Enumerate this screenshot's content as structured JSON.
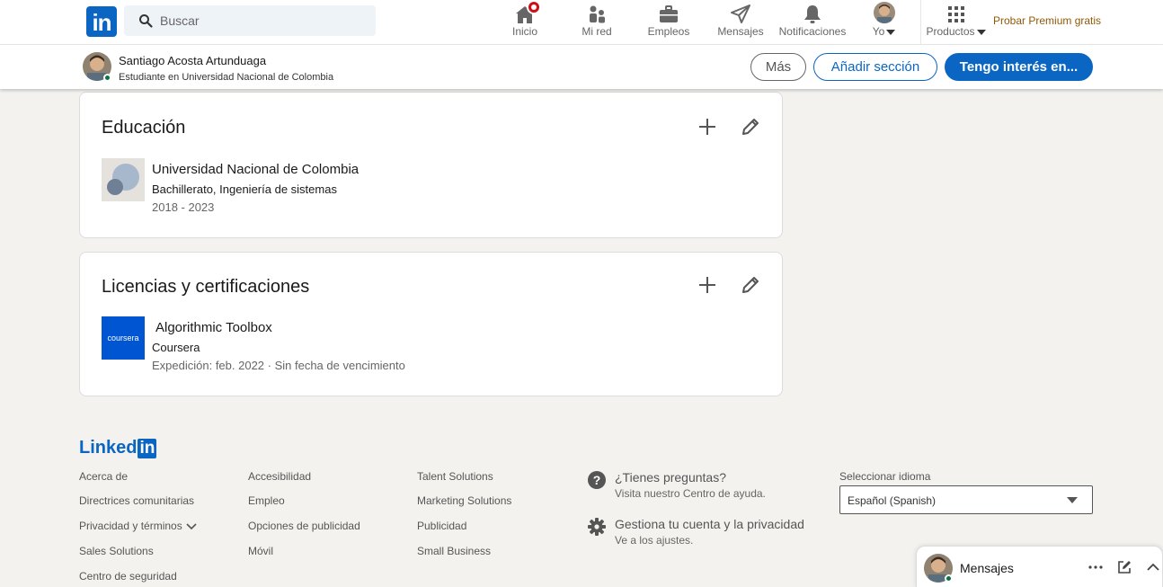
{
  "nav": {
    "logo": "in",
    "search_placeholder": "Buscar",
    "items": [
      {
        "label": "Inicio",
        "icon": "home-icon"
      },
      {
        "label": "Mi red",
        "icon": "people-icon"
      },
      {
        "label": "Empleos",
        "icon": "briefcase-icon"
      },
      {
        "label": "Mensajes",
        "icon": "send-icon"
      },
      {
        "label": "Notificaciones",
        "icon": "bell-icon"
      },
      {
        "label": "Yo",
        "icon": "avatar"
      },
      {
        "label": "Productos",
        "icon": "grid-icon"
      }
    ],
    "premium": "Probar Premium gratis",
    "accent": "#0a66c2",
    "notification_color": "#cc1016"
  },
  "profile_bar": {
    "name": "Santiago Acosta Artunduaga",
    "headline": "Estudiante en Universidad Nacional de Colombia",
    "more_label": "Más",
    "add_section_label": "Añadir sección",
    "interest_label": "Tengo interés en..."
  },
  "education": {
    "title": "Educación",
    "entries": [
      {
        "school": "Universidad Nacional de Colombia",
        "degree": "Bachillerato, Ingeniería de sistemas",
        "dates": "2018 - 2023"
      }
    ]
  },
  "licenses": {
    "title": "Licencias y certificaciones",
    "entries": [
      {
        "logo_text": "coursera",
        "name": "Algorithmic Toolbox",
        "issuer": "Coursera",
        "meta": "Expedición: feb. 2022 · Sin fecha de vencimiento"
      }
    ]
  },
  "footer": {
    "logo_text": "Linked",
    "logo_box": "in",
    "col1": [
      "Acerca de",
      "Directrices comunitarias",
      "Privacidad y términos",
      "Sales Solutions",
      "Centro de seguridad"
    ],
    "col2": [
      "Accesibilidad",
      "Empleo",
      "Opciones de publicidad",
      "Móvil"
    ],
    "col3": [
      "Talent Solutions",
      "Marketing Solutions",
      "Publicidad",
      "Small Business"
    ],
    "help": {
      "title": "¿Tienes preguntas?",
      "sub": "Visita nuestro Centro de ayuda."
    },
    "account": {
      "title": "Gestiona tu cuenta y la privacidad",
      "sub": "Ve a los ajustes."
    },
    "language_label": "Seleccionar idioma",
    "language_value": "Español (Spanish)"
  },
  "messaging": {
    "label": "Mensajes"
  }
}
